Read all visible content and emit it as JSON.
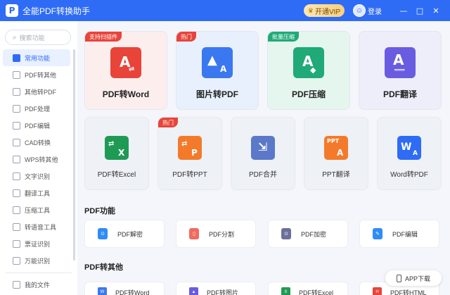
{
  "titlebar": {
    "title": "全能PDF转换助手",
    "vip_label": "开通VIP",
    "login_label": "登录",
    "minimize": "—",
    "maximize": "□",
    "close": "✕"
  },
  "sidebar": {
    "search_placeholder": "搜索功能",
    "items": [
      {
        "label": "常用功能"
      },
      {
        "label": "PDF转其他"
      },
      {
        "label": "其他转PDF"
      },
      {
        "label": "PDF处理"
      },
      {
        "label": "PDF编辑"
      },
      {
        "label": "CAD转换"
      },
      {
        "label": "WPS转其他"
      },
      {
        "label": "文字识别"
      },
      {
        "label": "翻译工具"
      },
      {
        "label": "压缩工具"
      },
      {
        "label": "转语音工具"
      },
      {
        "label": "票证识别"
      },
      {
        "label": "万能识别"
      }
    ],
    "my_files": "我的文件"
  },
  "big_cards": [
    {
      "label": "PDF转Word",
      "badge": "支持扫描件",
      "badge_color": "#e8443a",
      "bg": "#fdeeee",
      "icon_color": "#e8443a"
    },
    {
      "label": "图片转PDF",
      "badge": "热门",
      "badge_color": "#e8443a",
      "bg": "#e8f0fd",
      "icon_color": "#3a78f0"
    },
    {
      "label": "PDF压缩",
      "badge": "批量压缩",
      "badge_color": "#1faa78",
      "bg": "#e5f6ef",
      "icon_color": "#1faa78"
    },
    {
      "label": "PDF翻译",
      "badge": "",
      "badge_color": "",
      "bg": "#eeeefb",
      "icon_color": "#6a5ce0"
    }
  ],
  "mid_cards": [
    {
      "label": "PDF转Excel",
      "badge": "",
      "icon_color": "#1f9a55"
    },
    {
      "label": "PDF转PPT",
      "badge": "热门",
      "icon_color": "#f47a2b"
    },
    {
      "label": "PDF合并",
      "badge": "",
      "icon_color": "#5b79c8"
    },
    {
      "label": "PPT翻译",
      "badge": "",
      "icon_color": "#f47a2b"
    },
    {
      "label": "Word转PDF",
      "badge": "",
      "icon_color": "#2f6cf6"
    }
  ],
  "sections": {
    "pdf_functions": "PDF功能",
    "pdf_to_other": "PDF转其他"
  },
  "function_cards": [
    {
      "label": "PDF解密",
      "icon_color": "#2f8cf6"
    },
    {
      "label": "PDF分割",
      "icon_color": "#f06a5f"
    },
    {
      "label": "PDF加密",
      "icon_color": "#6b6f9b"
    },
    {
      "label": "PDF编辑",
      "icon_color": "#2f8cf6"
    }
  ],
  "bottom_cards": [
    {
      "label": "PDF转Word",
      "icon_color": "#3a78f0"
    },
    {
      "label": "PDF转图片",
      "icon_color": "#6a5ce0"
    },
    {
      "label": "PDF转Excel",
      "icon_color": "#1f9a55"
    },
    {
      "label": "PDF转HTML",
      "icon_color": "#e8443a"
    }
  ],
  "app_download": "APP下载"
}
